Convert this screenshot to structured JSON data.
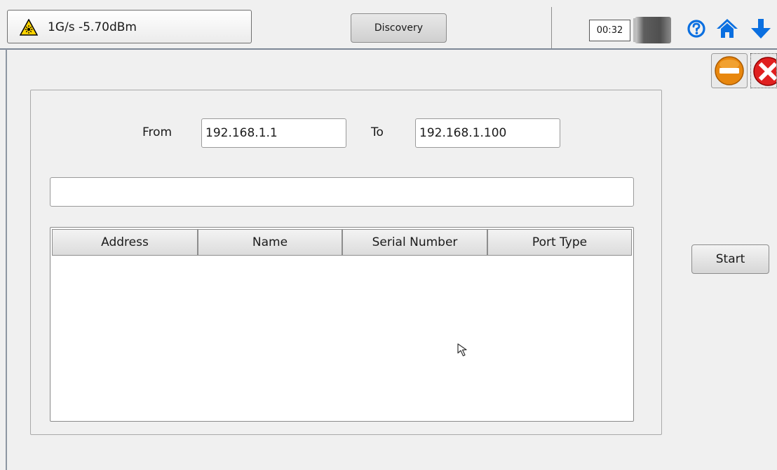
{
  "header": {
    "laser_status": "1G/s -5.70dBm",
    "discovery_label": "Discovery",
    "clock": "00:32",
    "icons": [
      "laser-warning-icon",
      "battery-icon",
      "help-icon",
      "home-icon",
      "down-arrow-icon",
      "minimize-icon",
      "close-icon"
    ],
    "colors": {
      "accent_blue": "#0a6fe0",
      "minimize_orange": "#e8870e",
      "close_red": "#e02020"
    }
  },
  "form": {
    "from_label": "From",
    "from_value": "192.168.1.1",
    "to_label": "To",
    "to_value": "192.168.1.100"
  },
  "progress": {
    "value": 0
  },
  "table": {
    "columns": [
      "Address",
      "Name",
      "Serial Number",
      "Port Type"
    ],
    "rows": []
  },
  "actions": {
    "start_label": "Start"
  }
}
